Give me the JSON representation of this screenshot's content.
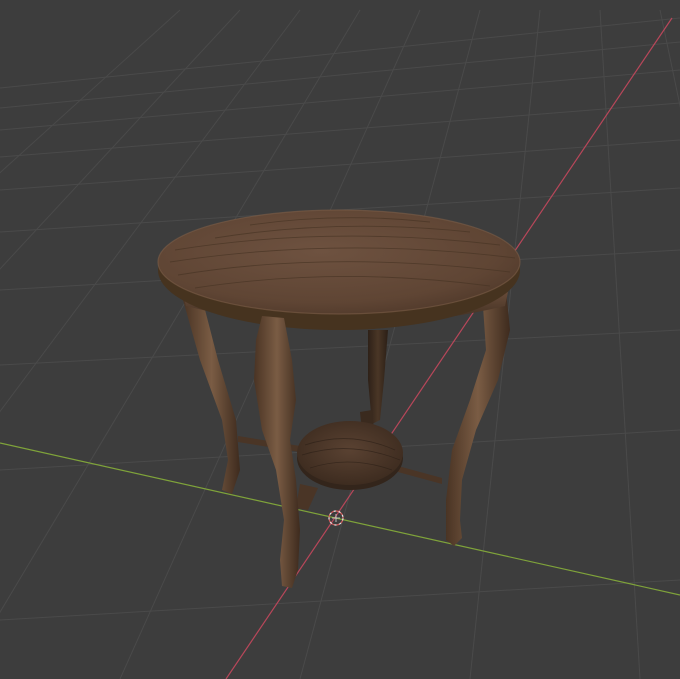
{
  "viewport": {
    "type": "3d-viewport",
    "background_color": "#3d3d3d",
    "grid_color": "#4a4a4a",
    "x_axis_color": "#c8495a",
    "y_axis_color": "#7fa33a",
    "object": "round-wooden-side-table",
    "object_colors": {
      "wood_top": "#6b4e3a",
      "wood_mid": "#5a4030",
      "wood_dark": "#3c2a1f",
      "wood_light": "#7d5f49"
    },
    "origin_marker_color": "#e8a090"
  }
}
